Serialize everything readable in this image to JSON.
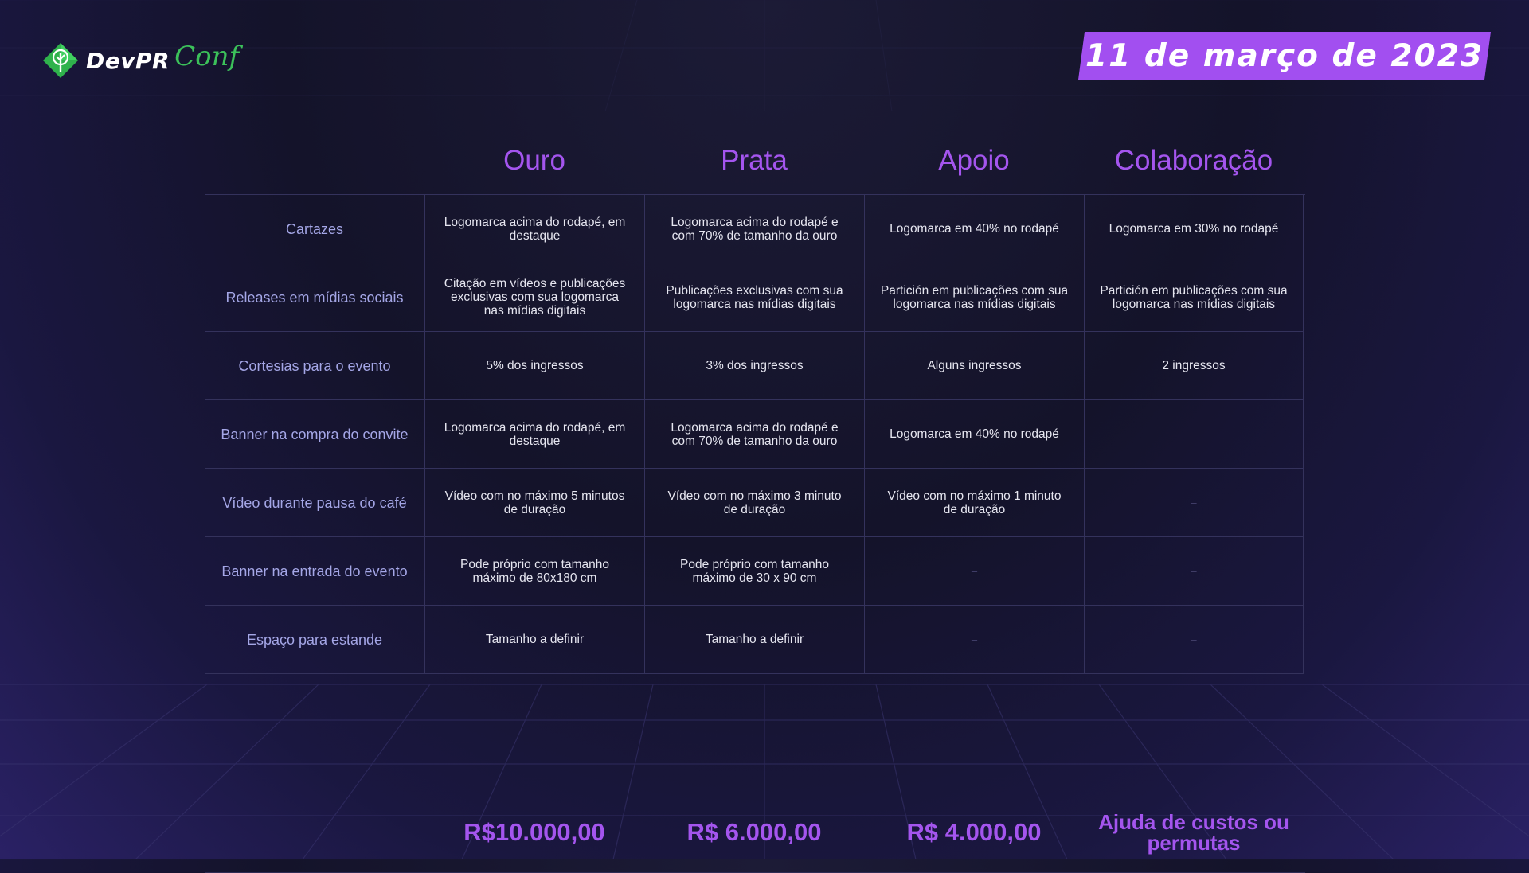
{
  "logo": {
    "dev": "DevPR",
    "conf": "Conf"
  },
  "date": "11 de março de 2023",
  "columns": [
    "Ouro",
    "Prata",
    "Apoio",
    "Colaboração"
  ],
  "rows": [
    {
      "label": "Cartazes",
      "cells": [
        "Logomarca acima do rodapé, em destaque",
        "Logomarca acima do rodapé e com 70% de tamanho da ouro",
        "Logomarca em 40% no rodapé",
        "Logomarca em 30% no rodapé"
      ]
    },
    {
      "label": "Releases em mídias sociais",
      "cells": [
        "Citação em vídeos e publicações exclusivas com sua logomarca nas mídias digitais",
        "Publicações exclusivas com sua logomarca nas mídias digitais",
        "Partición em publicações com sua logomarca nas mídias digitais",
        "Partición em publicações com sua logomarca nas mídias digitais"
      ]
    },
    {
      "label": "Cortesias para o evento",
      "cells": [
        "5% dos ingressos",
        "3% dos ingressos",
        "Alguns ingressos",
        "2 ingressos"
      ]
    },
    {
      "label": "Banner na compra do convite",
      "cells": [
        "Logomarca acima do rodapé, em destaque",
        "Logomarca acima do rodapé e com 70% de tamanho da ouro",
        "Logomarca em 40% no rodapé",
        "–"
      ]
    },
    {
      "label": "Vídeo durante pausa do café",
      "cells": [
        "Vídeo com no máximo 5 minutos de duração",
        "Vídeo com no máximo 3 minuto de duração",
        "Vídeo com no máximo 1 minuto de duração",
        "–"
      ]
    },
    {
      "label": "Banner na entrada do evento",
      "cells": [
        "Pode próprio com tamanho máximo de 80x180 cm",
        "Pode próprio com tamanho máximo de 30 x 90 cm",
        "–",
        "–"
      ]
    },
    {
      "label": "Espaço para estande",
      "cells": [
        "Tamanho a definir",
        "Tamanho a definir",
        "–",
        "–"
      ]
    }
  ],
  "prices": [
    "R$10.000,00",
    "R$ 6.000,00",
    "R$ 4.000,00",
    "Ajuda de custos ou permutas"
  ],
  "colors": {
    "accent": "#a455ee",
    "banner": "#a24ff0",
    "logo_green": "#3cc15a",
    "label": "#a4a6e6"
  }
}
